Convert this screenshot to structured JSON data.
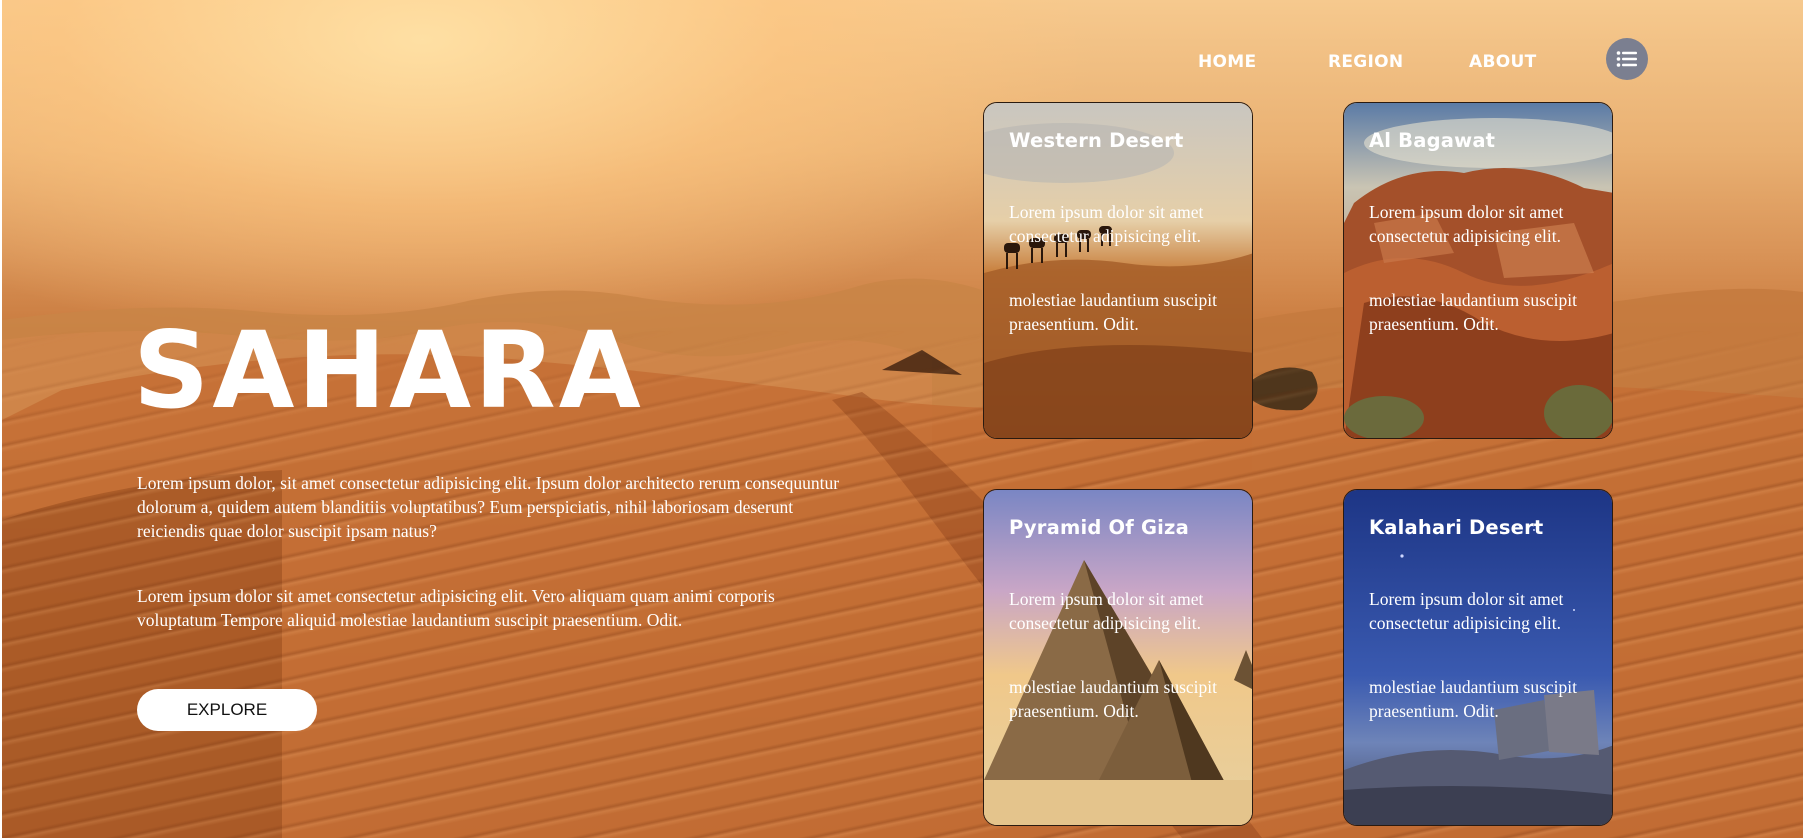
{
  "nav": {
    "links": [
      {
        "label": "HOME"
      },
      {
        "label": "REGION"
      },
      {
        "label": "ABOUT"
      }
    ],
    "menu_icon": "list-icon"
  },
  "hero": {
    "title": "SAHARA",
    "paragraph1": "Lorem ipsum dolor, sit amet consectetur adipisicing elit. Ipsum dolor architecto rerum consequuntur dolorum a, quidem autem blanditiis voluptatibus? Eum perspiciatis, nihil laboriosam deserunt reiciendis quae dolor suscipit ipsam natus?",
    "paragraph2": "Lorem ipsum dolor sit amet consectetur adipisicing elit. Vero aliquam quam animi corporis voluptatum Tempore aliquid molestiae laudantium suscipit praesentium. Odit.",
    "explore_label": "EXPLORE"
  },
  "cards": [
    {
      "title": "Western Desert",
      "text1": "Lorem ipsum dolor sit amet consectetur adipisicing elit.",
      "text2": "molestiae laudantium suscipit praesentium. Odit."
    },
    {
      "title": "Al Bagawat",
      "text1": "Lorem ipsum dolor sit amet consectetur adipisicing elit.",
      "text2": "molestiae laudantium suscipit praesentium. Odit."
    },
    {
      "title": "Pyramid Of Giza",
      "text1": "Lorem ipsum dolor sit amet consectetur adipisicing elit.",
      "text2": "molestiae laudantium suscipit praesentium. Odit."
    },
    {
      "title": "Kalahari Desert",
      "text1": "Lorem ipsum dolor sit amet consectetur adipisicing elit.",
      "text2": "molestiae laudantium suscipit praesentium. Odit."
    }
  ],
  "colors": {
    "menu_button": "#7b7f90",
    "sand": "#c4723a",
    "sky": "#f6c98e"
  }
}
